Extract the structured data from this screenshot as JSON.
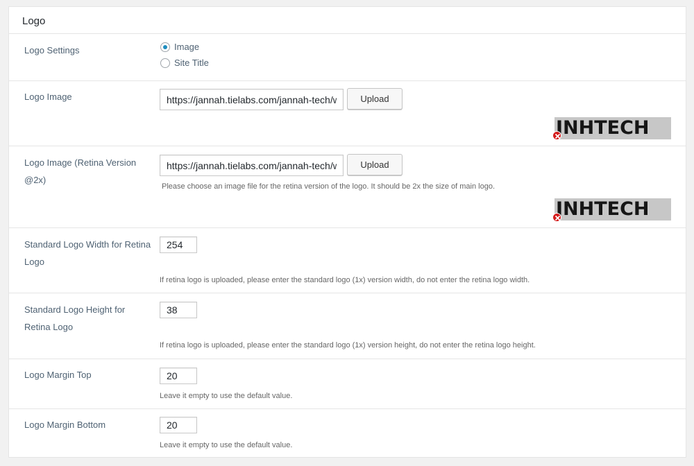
{
  "section": {
    "title": "Logo"
  },
  "logo_settings": {
    "label": "Logo Settings",
    "options": [
      {
        "label": "Image",
        "checked": true
      },
      {
        "label": "Site Title",
        "checked": false
      }
    ]
  },
  "logo_image": {
    "label": "Logo Image",
    "url": "https://jannah.tielabs.com/jannah-tech/wp",
    "upload_label": "Upload",
    "preview_text": "JNHTECH",
    "remove_icon": "remove-circle-icon"
  },
  "logo_retina": {
    "label": "Logo Image (Retina Version @2x)",
    "url": "https://jannah.tielabs.com/jannah-tech/wp",
    "upload_label": "Upload",
    "help": "Please choose an image file for the retina version of the logo. It should be 2x the size of main logo.",
    "preview_text": "JNHTECH",
    "remove_icon": "remove-circle-icon"
  },
  "std_width": {
    "label": "Standard Logo Width for Retina Logo",
    "value": "254",
    "help": "If retina logo is uploaded, please enter the standard logo (1x) version width, do not enter the retina logo width."
  },
  "std_height": {
    "label": "Standard Logo Height for Retina Logo",
    "value": "38",
    "help": "If retina logo is uploaded, please enter the standard logo (1x) version height, do not enter the retina logo height."
  },
  "margin_top": {
    "label": "Logo Margin Top",
    "value": "20",
    "help": "Leave it empty to use the default value."
  },
  "margin_bottom": {
    "label": "Logo Margin Bottom",
    "value": "20",
    "help": "Leave it empty to use the default value."
  },
  "colors": {
    "accent": "#1e8cbe",
    "remove": "#d41c1c",
    "label": "#4f6273"
  }
}
